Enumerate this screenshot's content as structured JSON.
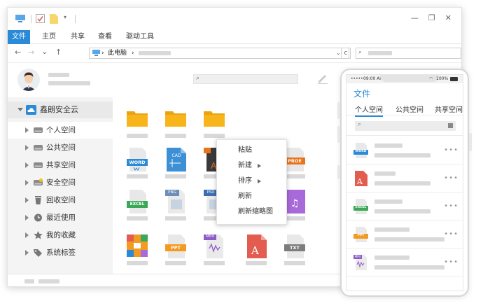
{
  "window": {
    "menu": [
      "文件",
      "主页",
      "共享",
      "查看",
      "驱动工具"
    ],
    "address": {
      "path_root": "此电脑",
      "separator": "›"
    }
  },
  "sidebar": {
    "root_label": "鑫朗安全云",
    "items": [
      {
        "label": "个人空间",
        "icon": "drive-icon"
      },
      {
        "label": "公共空间",
        "icon": "drive-icon"
      },
      {
        "label": "共享空间",
        "icon": "drive-icon"
      },
      {
        "label": "安全空间",
        "icon": "secure-drive-icon"
      },
      {
        "label": "回收空间",
        "icon": "trash-icon"
      },
      {
        "label": "最近使用",
        "icon": "clock-icon"
      },
      {
        "label": "我的收藏",
        "icon": "star-icon"
      },
      {
        "label": "系统标签",
        "icon": "tag-icon"
      }
    ]
  },
  "files": {
    "badges": {
      "word": "WORD",
      "cad": "CAD",
      "pro": "PROE",
      "excel": "EXCEL",
      "png": "PNG",
      "psd": "PSD",
      "ppt": "PPT",
      "mp4": "MP4",
      "txt": "TXT"
    }
  },
  "context_menu": [
    "粘贴",
    "新建",
    "排序",
    "刷新",
    "刷新缩略图"
  ],
  "phone": {
    "time": "09:00 AM",
    "battery": "100%",
    "title": "文件",
    "tabs": [
      "个人空间",
      "公共空间",
      "共享空间"
    ],
    "rows": [
      "word",
      "pdf",
      "excel",
      "ppt",
      "mp4"
    ],
    "row_badges": {
      "word": "WORD",
      "excel": "EXCEL",
      "ppt": "PPT",
      "mp4": "MP4"
    }
  },
  "colors": {
    "accent": "#2b8ad8",
    "folder": "#f7b51b",
    "word": "#2b8ad8",
    "excel": "#3aa856",
    "ppt": "#f39a20",
    "pdf": "#e25c4f"
  }
}
